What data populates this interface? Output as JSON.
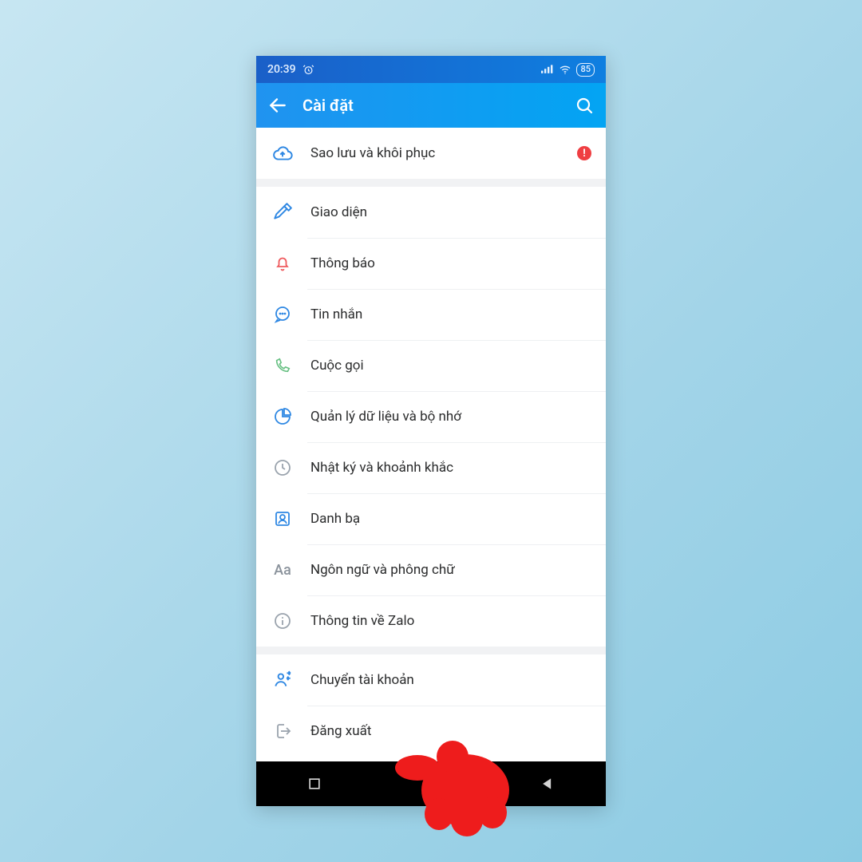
{
  "status": {
    "time": "20:39",
    "battery": "85"
  },
  "header": {
    "title": "Cài đặt"
  },
  "rows": {
    "backup": {
      "label": "Sao lưu và khôi phục"
    },
    "theme": {
      "label": "Giao diện"
    },
    "notif": {
      "label": "Thông báo"
    },
    "msg": {
      "label": "Tin nhắn"
    },
    "call": {
      "label": "Cuộc gọi"
    },
    "data": {
      "label": "Quản lý dữ liệu và bộ nhớ"
    },
    "diary": {
      "label": "Nhật ký và khoảnh khắc"
    },
    "contacts": {
      "label": "Danh bạ"
    },
    "lang": {
      "label": "Ngôn ngữ và phông chữ"
    },
    "about": {
      "label": "Thông tin về Zalo"
    },
    "switch": {
      "label": "Chuyển tài khoản"
    },
    "logout": {
      "label": "Đăng xuất"
    }
  },
  "icons": {
    "lang_glyph": "Aa",
    "alert_glyph": "!"
  }
}
